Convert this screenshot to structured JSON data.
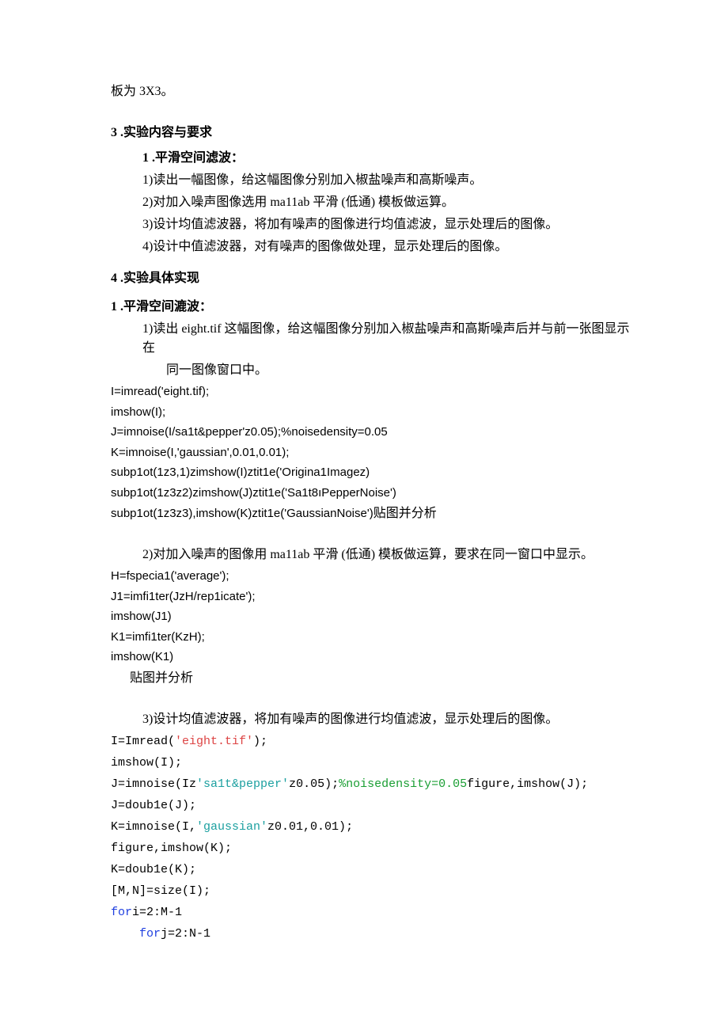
{
  "p0": "板为 3X3。",
  "h1": "3 .实验内容与要求",
  "s1": {
    "title": "1 .平滑空间滤波：",
    "l1": "1)读出一幅图像，给这幅图像分别加入椒盐噪声和高斯噪声。",
    "l2": "2)对加入噪声图像选用 ma11ab 平滑 (低通) 模板做运算。",
    "l3": "3)设计均值滤波器，将加有噪声的图像进行均值滤波，显示处理后的图像。",
    "l4": "4)设计中值滤波器，对有噪声的图像做处理，显示处理后的图像。"
  },
  "h2": "4 .实验具体实现",
  "s2": {
    "title": "1 .平滑空间漉波：",
    "l1": "1)读出 eight.tif 这幅图像，给这幅图像分别加入椒盐噪声和高斯噪声后并与前一张图显示在",
    "l1b": "同一图像窗口中。"
  },
  "code1": {
    "c1": "I=imread('eight.tif);",
    "c2": "imshow(I);",
    "c3": "J=imnoise(I/sa1t&pepper'z0.05);%noisedensity=0.05",
    "c4": "K=imnoise(I,'gaussian',0.01,0.01);",
    "c5": "subp1ot(1z3,1)zimshow(I)ztit1e('Origina1Imagez)",
    "c6": "subp1ot(1z3z2)zimshow(J)ztit1e('Sa1t8ıPepperNoise')",
    "c7a": "subp1ot(1z3z3),imshow(K)ztit1e('GaussianNoise')",
    "c7b": "贴图并分析"
  },
  "s3": "2)对加入噪声的图像用 ma11ab 平滑 (低通) 模板做运算，要求在同一窗口中显示。",
  "code2": {
    "c1": "H=fspecia1('average');",
    "c2": "J1=imfi1ter(JzH/rep1icate');",
    "c3": "imshow(J1)",
    "c4": "K1=imfi1ter(KzH);",
    "c5": "imshow(K1)",
    "c6": "贴图并分析"
  },
  "s4": "3)设计均值滤波器，将加有噪声的图像进行均值滤波，显示处理后的图像。",
  "code3": {
    "c1a": "I=Imread(",
    "c1b": "'eight.tif'",
    "c1c": ");",
    "c2": "imshow(I);",
    "c3a": "J=imnoise(Iz",
    "c3b": "'sa1t&pepper'",
    "c3c": "z0.05);",
    "c3d": "%noisedensity=0.05",
    "c3e": "figure,imshow(J);",
    "c4": "J=doub1e(J);",
    "c5a": "K=imnoise(I,",
    "c5b": "'gaussian'",
    "c5c": "z0.01,0.01);",
    "c6": "figure,imshow(K);",
    "c7": "K=doub1e(K);",
    "c8": "[M,N]=size(I);",
    "c9a": "for",
    "c9b": "i=2:M-1",
    "c10a": "for",
    "c10b": "j=2:N-1"
  }
}
